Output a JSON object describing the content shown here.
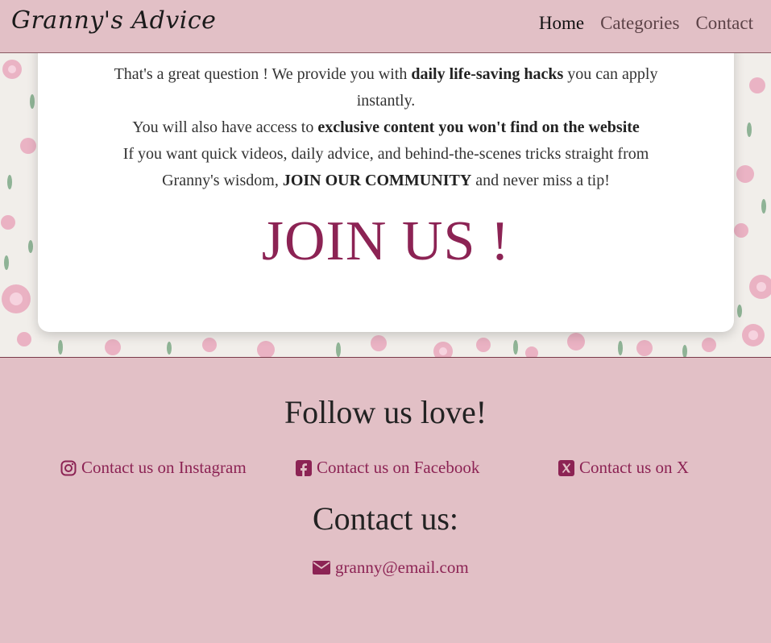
{
  "navbar": {
    "brand": "Granny's Advice",
    "links": [
      {
        "label": "Home"
      },
      {
        "label": "Categories"
      },
      {
        "label": "Contact"
      }
    ]
  },
  "card": {
    "paragraph1": {
      "t1": "That's a great question ! We provide you with ",
      "b1": "daily life-saving hacks",
      "t2": " you can apply instantly."
    },
    "paragraph2": {
      "t1": "You will also have access to ",
      "b1": "exclusive content you won't find on the website"
    },
    "paragraph3": {
      "t1": "If you want quick videos, daily advice, and behind-the-scenes tricks straight from Granny's wisdom, ",
      "b1": "JOIN OUR COMMUNITY",
      "t2": " and never miss a tip!"
    },
    "join": "JOIN US !"
  },
  "footer": {
    "follow_title": "Follow us love!",
    "socials": [
      {
        "label": "Contact us on Instagram",
        "icon": "instagram-icon"
      },
      {
        "label": "Contact us on Facebook",
        "icon": "facebook-icon"
      },
      {
        "label": "Contact us on X",
        "icon": "x-icon"
      }
    ],
    "contact_title": "Contact us:",
    "email": "granny@email.com",
    "email_icon": "envelope-icon"
  },
  "colors": {
    "nav_bg": "#e2c0c6",
    "accent": "#8c2354",
    "card_bg": "#ffffff"
  }
}
